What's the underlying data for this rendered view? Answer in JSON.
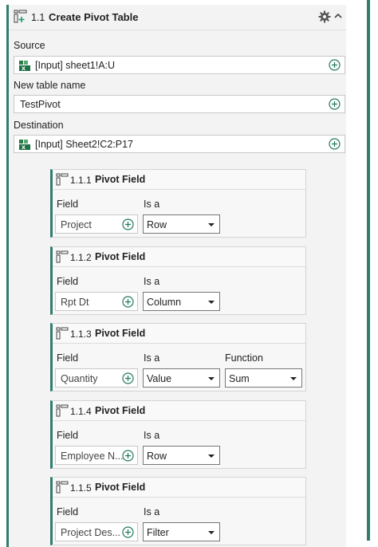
{
  "action": {
    "number": "1.1",
    "title": "Create Pivot Table",
    "icon": "pivot-table-add-icon"
  },
  "source": {
    "label": "Source",
    "value": "[Input] sheet1!A:U"
  },
  "new_table_name": {
    "label": "New table name",
    "value": "TestPivot"
  },
  "destination": {
    "label": "Destination",
    "value": "[Input] Sheet2!C2:P17"
  },
  "pivot_fields": [
    {
      "number": "1.1.1",
      "title": "Pivot Field",
      "field_label": "Field",
      "is_a_label": "Is a",
      "field": "Project",
      "is_a": "Row"
    },
    {
      "number": "1.1.2",
      "title": "Pivot Field",
      "field_label": "Field",
      "is_a_label": "Is a",
      "field": "Rpt Dt",
      "is_a": "Column"
    },
    {
      "number": "1.1.3",
      "title": "Pivot Field",
      "field_label": "Field",
      "is_a_label": "Is a",
      "field": "Quantity",
      "is_a": "Value",
      "function_label": "Function",
      "function": "Sum"
    },
    {
      "number": "1.1.4",
      "title": "Pivot Field",
      "field_label": "Field",
      "is_a_label": "Is a",
      "field": "Employee N...",
      "is_a": "Row"
    },
    {
      "number": "1.1.5",
      "title": "Pivot Field",
      "field_label": "Field",
      "is_a_label": "Is a",
      "field": "Project Des...",
      "is_a": "Filter"
    }
  ],
  "colors": {
    "accent": "#2e7d6e",
    "add_icon": "#1f7a5a",
    "excel_green": "#1e7145"
  }
}
